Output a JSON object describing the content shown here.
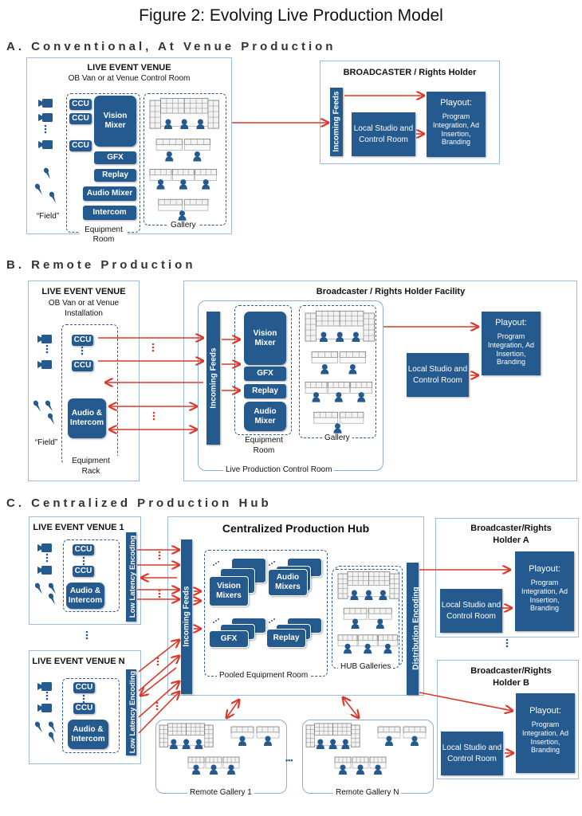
{
  "title": "Figure 2: Evolving Live Production Model",
  "colors": {
    "block": "#255a8f",
    "arrow": "#d93a2b",
    "panel_border": "#9cbde0",
    "dashed": "#2f5d93"
  },
  "sectionA": {
    "heading": "A. Conventional, At Venue Production",
    "venue": {
      "title": "LIVE EVENT VENUE",
      "subtitle": "OB Van or at Venue Control Room",
      "ccu": [
        "CCU",
        "CCU",
        "CCU"
      ],
      "vision_mixer": "Vision Mixer",
      "gfx": "GFX",
      "replay": "Replay",
      "audio_mixer": "Audio Mixer",
      "intercom": "Intercom",
      "field": "“Field”",
      "equipment_room": "Equipment Room",
      "gallery": "Gallery"
    },
    "broadcaster": {
      "title": "BROADCASTER / Rights Holder",
      "incoming_feeds": "Incoming Feeds",
      "local": "Local Studio and Control Room",
      "playout_title": "Playout:",
      "playout_body": "Program Integration, Ad Insertion, Branding"
    }
  },
  "sectionB": {
    "heading": "B. Remote Production",
    "venue": {
      "title": "LIVE EVENT VENUE",
      "subtitle": "OB Van or at Venue Installation",
      "ccu": [
        "CCU",
        "CCU"
      ],
      "audio_intercom": "Audio & Intercom",
      "field": "“Field”",
      "equipment_rack": "Equipment Rack"
    },
    "facility": {
      "title": "Broadcaster / Rights Holder Facility",
      "incoming_feeds": "Incoming Feeds",
      "vision_mixer": "Vision Mixer",
      "gfx": "GFX",
      "replay": "Replay",
      "audio_mixer": "Audio Mixer",
      "equipment_room": "Equipment Room",
      "gallery": "Gallery",
      "control_room": "Live Production Control Room",
      "local": "Local Studio and Control Room",
      "playout_title": "Playout:",
      "playout_body": "Program Integration, Ad Insertion, Branding"
    }
  },
  "sectionC": {
    "heading": "C. Centralized Production Hub",
    "venue1": {
      "title": "LIVE EVENT VENUE 1",
      "ccu": [
        "CCU",
        "CCU"
      ],
      "audio_intercom": "Audio & Intercom",
      "encoding": "Low Latency Encoding"
    },
    "venueN": {
      "title": "LIVE EVENT VENUE N",
      "ccu": [
        "CCU",
        "CCU"
      ],
      "audio_intercom": "Audio & Intercom",
      "encoding": "Low Latency Encoding"
    },
    "hub": {
      "title": "Centralized Production Hub",
      "incoming_feeds": "Incoming Feeds",
      "vision_mixers": "Vision Mixers",
      "audio_mixers": "Audio Mixers",
      "gfx": "GFX",
      "replay": "Replay",
      "pooled_room": "Pooled Equipment Room",
      "hub_galleries": "HUB Galleries",
      "distribution": "Distribution Encoding"
    },
    "holderA": {
      "title": "Broadcaster/Rights Holder A",
      "local": "Local Studio and Control Room",
      "playout_title": "Playout:",
      "playout_body": "Program Integration, Ad Insertion, Branding"
    },
    "holderB": {
      "title": "Broadcaster/Rights Holder B",
      "local": "Local Studio and Control Room",
      "playout_title": "Playout:",
      "playout_body": "Program Integration, Ad Insertion, Branding"
    },
    "remote_gallery_1": "Remote Gallery 1",
    "remote_gallery_n": "Remote Gallery N",
    "ellipsis": "•••"
  }
}
